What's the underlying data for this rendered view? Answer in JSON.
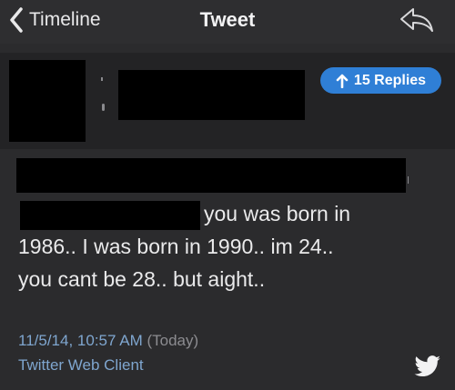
{
  "navbar": {
    "back_label": "Timeline",
    "title": "Tweet",
    "back_icon": "chevron-left-icon",
    "reply_icon": "reply-arrow-icon"
  },
  "parent_tweet": {
    "replies_label": "15 Replies",
    "replies_icon": "arrow-up-icon",
    "accent_color": "#2f7fd6"
  },
  "tweet": {
    "line1": "you was born in",
    "line2": "1986.. I was born in 1990.. im 24..",
    "line3": "you cant be 28.. but aight..",
    "timestamp": "11/5/14, 10:57 AM",
    "relative_time": "(Today)",
    "client": "Twitter Web Client",
    "brand_icon": "twitter-bird-icon"
  }
}
